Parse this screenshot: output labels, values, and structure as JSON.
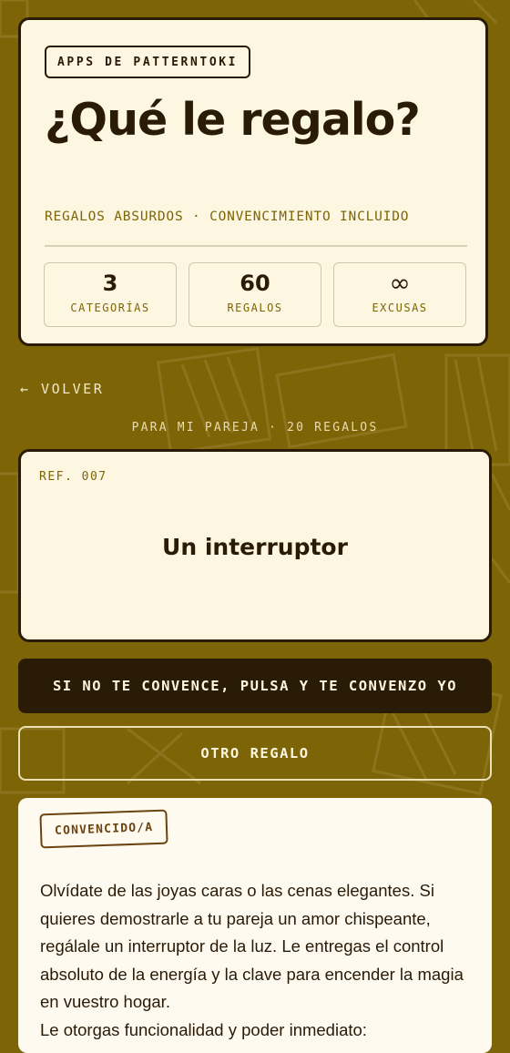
{
  "header": {
    "brand": "APPS DE PATTERNTOKI",
    "title": "¿Qué le regalo?",
    "subtitle": "REGALOS ABSURDOS · CONVENCIMIENTO INCLUIDO",
    "stats": [
      {
        "value": "3",
        "label": "CATEGORÍAS"
      },
      {
        "value": "60",
        "label": "REGALOS"
      },
      {
        "value": "∞",
        "label": "EXCUSAS"
      }
    ]
  },
  "nav": {
    "back_label": "← VOLVER"
  },
  "context_line": "PARA MI PAREJA · 20 REGALOS",
  "gift": {
    "ref": "REF. 007",
    "name": "Un interruptor"
  },
  "actions": {
    "convince_label": "SI NO TE CONVENCE, PULSA Y TE CONVENZO YO",
    "other_label": "OTRO REGALO"
  },
  "answer": {
    "stamp": "CONVENCIDO/A",
    "paragraph1": "Olvídate de las joyas caras o las cenas elegantes. Si quieres demostrarle a tu pareja un amor chispeante, regálale un interruptor de la luz. Le entregas el control absoluto de la energía y la clave para encender la magia en vuestro hogar.",
    "paragraph2": "Le otorgas funcionalidad y poder inmediato:"
  },
  "colors": {
    "background": "#7d6407",
    "card": "#fdf6e1",
    "ink": "#2a1b07",
    "accent": "#7d6407"
  }
}
